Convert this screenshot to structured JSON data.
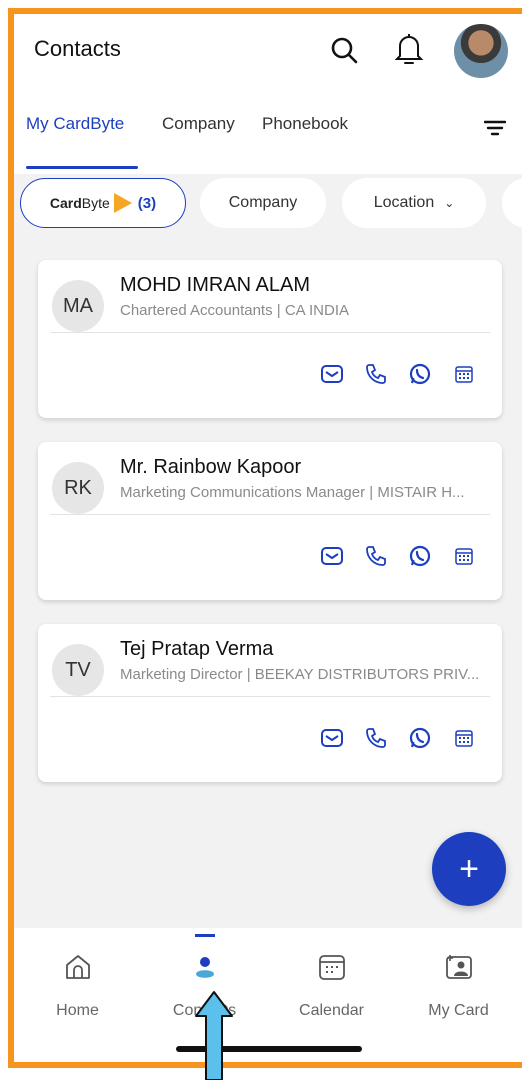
{
  "header": {
    "title": "Contacts",
    "icons": [
      "search-icon",
      "bell-icon",
      "avatar"
    ]
  },
  "tabs": [
    {
      "label": "My CardByte",
      "active": true
    },
    {
      "label": "Company",
      "active": false
    },
    {
      "label": "Phonebook",
      "active": false
    }
  ],
  "filters": {
    "cardbyte_brand_a": "Card",
    "cardbyte_brand_b": "Byte",
    "cardbyte_count": "(3)",
    "company": "Company",
    "location": "Location"
  },
  "contacts": [
    {
      "initials": "MA",
      "name": "MOHD IMRAN ALAM",
      "subtitle": "Chartered Accountants | CA INDIA"
    },
    {
      "initials": "RK",
      "name": "Mr. Rainbow Kapoor",
      "subtitle": "Marketing Communications Manager | MISTAIR H..."
    },
    {
      "initials": "TV",
      "name": "Tej Pratap Verma",
      "subtitle": "Marketing Director | BEEKAY DISTRIBUTORS PRIV..."
    }
  ],
  "fab": {
    "label": "+"
  },
  "bottom_nav": [
    {
      "label": "Home",
      "icon": "home-icon"
    },
    {
      "label": "Contacts",
      "icon": "contacts-icon",
      "active": true
    },
    {
      "label": "Calendar",
      "icon": "calendar-icon"
    },
    {
      "label": "My Card",
      "icon": "my-card-icon"
    }
  ],
  "colors": {
    "accent": "#1d3fbf",
    "frame": "#f7941d",
    "background": "#f2f2f2",
    "arrow": "#5bc0eb"
  }
}
